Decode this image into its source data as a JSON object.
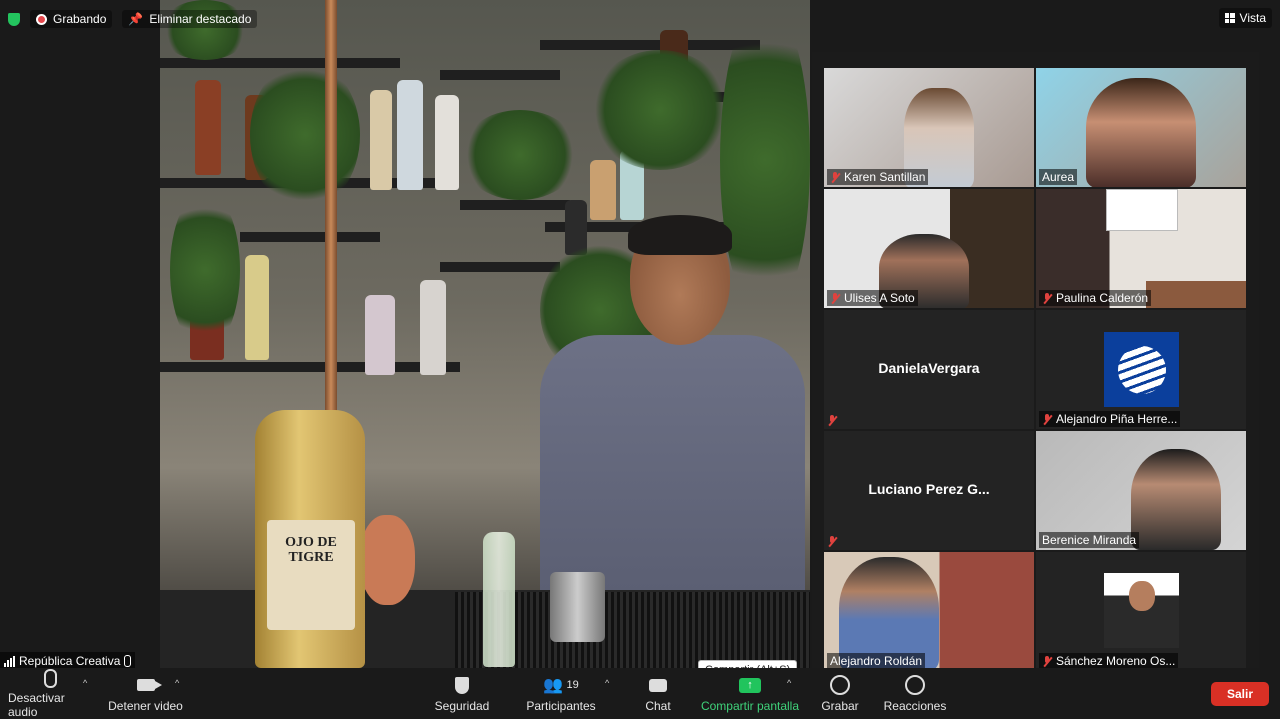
{
  "top_bar": {
    "recording_label": "Grabando",
    "unpin_label": "Eliminar destacado",
    "view_label": "Vista"
  },
  "main_video": {
    "presenter_name": "República Creativa",
    "bottle_label": "OJO DE TIGRE"
  },
  "gallery": {
    "participants": [
      {
        "name": "Karen Santillan",
        "muted": true,
        "video": true
      },
      {
        "name": "Aurea",
        "muted": false,
        "video": true
      },
      {
        "name": "Ulises A Soto",
        "muted": true,
        "video": true
      },
      {
        "name": "Paulina Calderón",
        "muted": true,
        "video": true
      },
      {
        "name": "DanielaVergara",
        "muted": true,
        "video": false
      },
      {
        "name": "Alejandro Piña Herre...",
        "muted": true,
        "video": false
      },
      {
        "name": "Luciano Perez G...",
        "muted": true,
        "video": false
      },
      {
        "name": "Berenice Miranda",
        "muted": false,
        "video": true
      },
      {
        "name": "Alejandro Roldán",
        "muted": false,
        "video": true
      },
      {
        "name": "Sánchez Moreno Os...",
        "muted": true,
        "video": false
      }
    ]
  },
  "toolbar": {
    "mute_label": "Desactivar audio",
    "video_label": "Detener video",
    "security_label": "Seguridad",
    "participants_label": "Participantes",
    "participants_count": "19",
    "chat_label": "Chat",
    "share_label": "Compartir pantalla",
    "share_tooltip": "Compartir (Alt+S)",
    "record_label": "Grabar",
    "reactions_label": "Reacciones",
    "leave_label": "Salir"
  },
  "colors": {
    "accent_green": "#21c45d",
    "leave_red": "#d93025",
    "mute_red": "#e0423e"
  }
}
